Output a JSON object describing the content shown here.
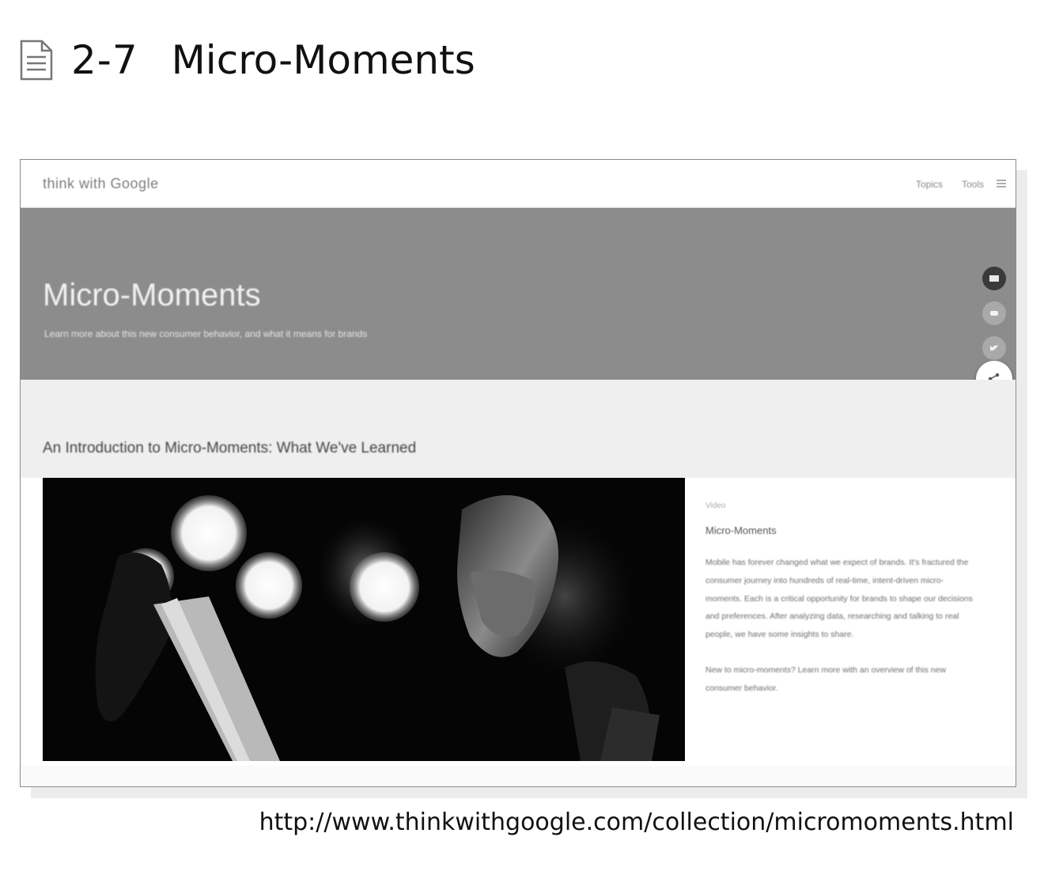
{
  "figure": {
    "number": "2-7",
    "title": "Micro-Moments",
    "icon": "document-icon",
    "source_url": "http://www.thinkwithgoogle.com/collection/micromoments.html"
  },
  "site": {
    "logo": "think with Google",
    "nav_links": [
      "Topics",
      "Tools"
    ],
    "menu_icon": "menu-icon"
  },
  "hero": {
    "title": "Micro-Moments",
    "subtitle": "Learn more about this new consumer behavior, and what it means for brands",
    "background_color": "#8c8c8c"
  },
  "share_rail": {
    "icons": [
      "email-icon",
      "googleplus-icon",
      "twitter-icon",
      "linkedin-icon"
    ],
    "fab_icon": "share-icon"
  },
  "intro": {
    "heading": "An Introduction to Micro-Moments: What We've Learned"
  },
  "card": {
    "meta": "Video",
    "title": "Micro-Moments",
    "body": "Mobile has forever changed what we expect of brands. It's fractured the consumer journey into hundreds of real-time, intent-driven micro-moments. Each is a critical opportunity for brands to shape our decisions and preferences. After analyzing data, researching and talking to real people, we have some insights to share.",
    "body2": "New to micro-moments? Learn more with an overview of this new consumer behavior."
  }
}
